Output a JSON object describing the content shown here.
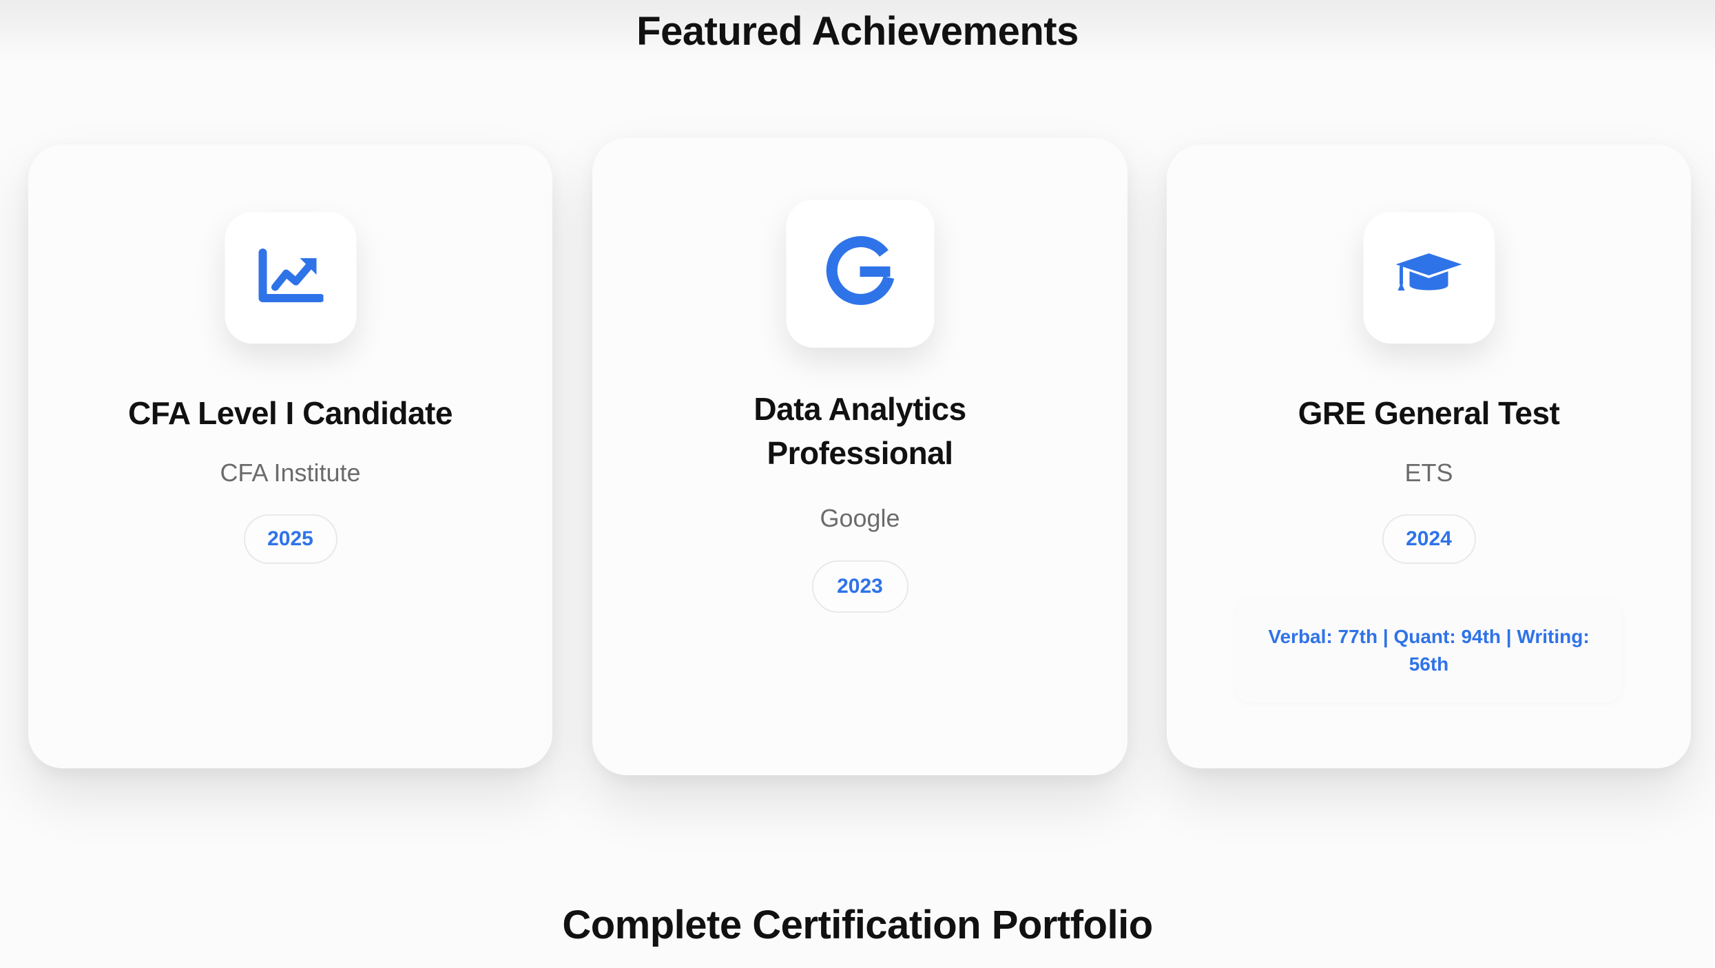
{
  "featured": {
    "title": "Featured Achievements"
  },
  "cards": [
    {
      "icon": "chart-line-icon",
      "title": "CFA Level I Candidate",
      "issuer": "CFA Institute",
      "year": "2025"
    },
    {
      "icon": "google-icon",
      "title": "Data Analytics Professional",
      "issuer": "Google",
      "year": "2023"
    },
    {
      "icon": "graduation-cap-icon",
      "title": "GRE General Test",
      "issuer": "ETS",
      "year": "2024",
      "scores": "Verbal: 77th | Quant: 94th | Writing: 56th"
    }
  ],
  "portfolio": {
    "title": "Complete Certification Portfolio"
  },
  "colors": {
    "accent": "#2f73e8",
    "background": "#fbfbfb",
    "card": "#fcfcfc",
    "muted_text": "#6b6b6b"
  }
}
